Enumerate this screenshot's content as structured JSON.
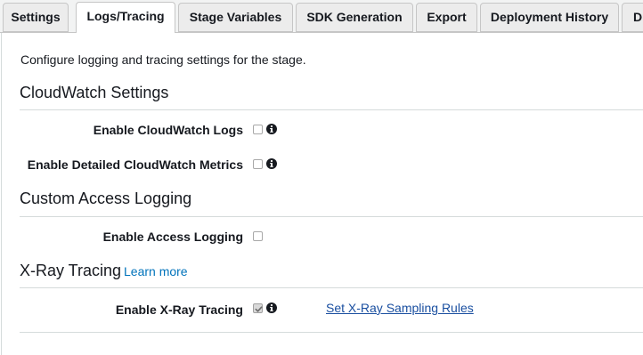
{
  "tabs": [
    {
      "label": "Settings",
      "active": false
    },
    {
      "label": "Logs/Tracing",
      "active": true
    },
    {
      "label": "Stage Variables",
      "active": false
    },
    {
      "label": "SDK Generation",
      "active": false
    },
    {
      "label": "Export",
      "active": false
    },
    {
      "label": "Deployment History",
      "active": false
    },
    {
      "label": "D",
      "active": false
    }
  ],
  "intro_text": "Configure logging and tracing settings for the stage.",
  "sections": {
    "cloudwatch": {
      "title": "CloudWatch Settings",
      "logs_label": "Enable CloudWatch Logs",
      "logs_checked": false,
      "metrics_label": "Enable Detailed CloudWatch Metrics",
      "metrics_checked": false
    },
    "access_logging": {
      "title": "Custom Access Logging",
      "label": "Enable Access Logging",
      "checked": false
    },
    "xray": {
      "title": "X-Ray Tracing",
      "learn_more": "Learn more",
      "label": "Enable X-Ray Tracing",
      "checked": true,
      "sampling_rules_link": "Set X-Ray Sampling Rules"
    }
  },
  "icons": {
    "info": "info-icon",
    "check": "checkmark-icon"
  },
  "colors": {
    "link": "#0073bb",
    "tab_bar": "#f2f3f3",
    "divider": "#d5dbdb"
  }
}
